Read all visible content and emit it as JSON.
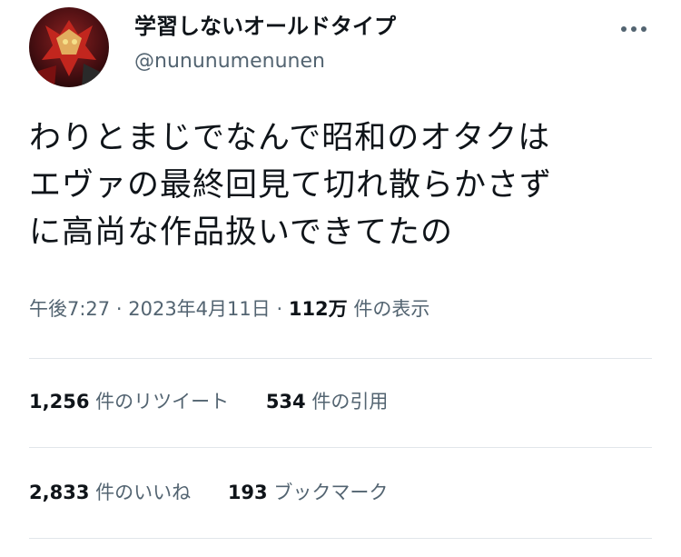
{
  "author": {
    "display_name": "学習しないオールドタイプ",
    "handle": "@nununumenunen"
  },
  "tweet": {
    "lines": [
      "わりとまじでなんで昭和のオタクは",
      "エヴァの最終回見て切れ散らかさず",
      "に高尚な作品扱いできてたの"
    ]
  },
  "meta": {
    "time": "午後7:27",
    "separator": "·",
    "date": "2023年4月11日",
    "views_count": "112万",
    "views_label": "件の表示"
  },
  "stats": {
    "retweets": {
      "count": "1,256",
      "label": "件のリツイート"
    },
    "quotes": {
      "count": "534",
      "label": "件の引用"
    },
    "likes": {
      "count": "2,833",
      "label": "件のいいね"
    },
    "bookmarks": {
      "count": "193",
      "label": "ブックマーク"
    }
  },
  "icons": {
    "more": "more-options-icon",
    "avatar": "user-avatar"
  },
  "colors": {
    "primary_text": "#0f1419",
    "secondary_text": "#536471",
    "divider": "#e1e6ea"
  }
}
